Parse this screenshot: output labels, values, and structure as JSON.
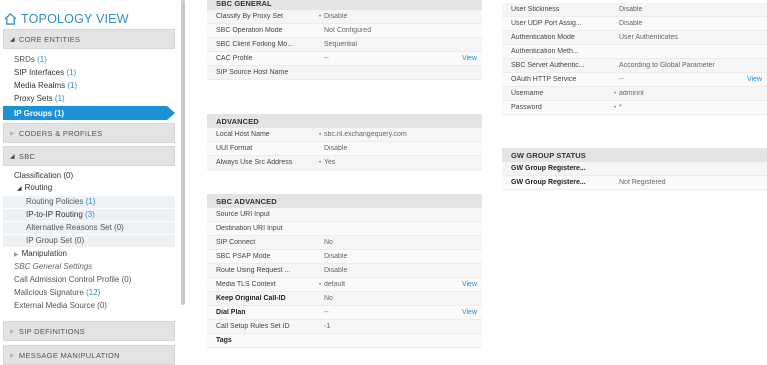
{
  "sidebar": {
    "title": "TOPOLOGY VIEW",
    "core_entities": "CORE ENTITIES",
    "items": [
      {
        "label": "SRDs",
        "count": "(1)"
      },
      {
        "label": "SIP Interfaces",
        "count": "(1)"
      },
      {
        "label": "Media Realms",
        "count": "(1)"
      },
      {
        "label": "Proxy Sets",
        "count": "(1)"
      },
      {
        "label": "IP Groups (1)",
        "count": ""
      }
    ],
    "codecs_profiles": "CODERS & PROFILES",
    "sbc": "SBC",
    "sbc_items": {
      "classification": "Classification (0)",
      "routing": "Routing",
      "routing_policies": "Routing Policies",
      "routing_policies_count": "(1)",
      "ip_to_ip": "IP-to-IP Routing",
      "ip_to_ip_count": "(3)",
      "alt_reasons": "Alternative Reasons Set (0)",
      "ip_group_set": "IP Group Set (0)",
      "manipulation": "Manipulation",
      "general_settings": "SBC General Settings",
      "cac_profile": "Call Admission Control Profile (0)",
      "malicious": "Malicious Signature",
      "malicious_count": "(12)",
      "external_media": "External Media Source (0)"
    },
    "sip_definitions": "SIP DEFINITIONS",
    "message_manipulation": "MESSAGE MANIPULATION"
  },
  "sbc_general": {
    "title": "SBC GENERAL",
    "rows": [
      {
        "label": "Classify By Proxy Set",
        "dot": "•",
        "value": "Disable",
        "view": ""
      },
      {
        "label": "SBC Operation Mode",
        "dot": "",
        "value": "Not Configured",
        "view": ""
      },
      {
        "label": "SBC Client Forking Mo...",
        "dot": "",
        "value": "Sequential",
        "view": ""
      },
      {
        "label": "CAC Profile",
        "dot": "",
        "value": "--",
        "view": "View"
      },
      {
        "label": "SIP Source Host Name",
        "dot": "",
        "value": "",
        "view": ""
      }
    ]
  },
  "advanced": {
    "title": "ADVANCED",
    "rows": [
      {
        "label": "Local Host Name",
        "dot": "•",
        "value": "sbc.nl.exchangequery.com",
        "view": ""
      },
      {
        "label": "UUI Format",
        "dot": "",
        "value": "Disable",
        "view": ""
      },
      {
        "label": "Always Use Src Address",
        "dot": "•",
        "value": "Yes",
        "view": ""
      }
    ]
  },
  "sbc_advanced": {
    "title": "SBC ADVANCED",
    "rows": [
      {
        "label": "Source URI Input",
        "dot": "",
        "value": "",
        "view": "",
        "bold": false
      },
      {
        "label": "Destination URI Input",
        "dot": "",
        "value": "",
        "view": "",
        "bold": false
      },
      {
        "label": "SIP Connect",
        "dot": "",
        "value": "No",
        "view": "",
        "bold": false
      },
      {
        "label": "SBC PSAP Mode",
        "dot": "",
        "value": "Disable",
        "view": "",
        "bold": false
      },
      {
        "label": "Route Using Request ...",
        "dot": "",
        "value": "Disable",
        "view": "",
        "bold": false
      },
      {
        "label": "Media TLS Context",
        "dot": "•",
        "value": "default",
        "view": "View",
        "bold": false
      },
      {
        "label": "Keep Original Call-ID",
        "dot": "",
        "value": "No",
        "view": "",
        "bold": true
      },
      {
        "label": "Dial Plan",
        "dot": "",
        "value": "--",
        "view": "View",
        "bold": true
      },
      {
        "label": "Call Setup Rules Set ID",
        "dot": "",
        "value": "-1",
        "view": "",
        "bold": false
      },
      {
        "label": "Tags",
        "dot": "",
        "value": "",
        "view": "",
        "bold": true
      }
    ]
  },
  "right_top": {
    "rows": [
      {
        "label": "User Stickiness",
        "dot": "",
        "value": "Disable",
        "view": ""
      },
      {
        "label": "User UDP Port Assig...",
        "dot": "",
        "value": "Disable",
        "view": ""
      },
      {
        "label": "Authentication Mode",
        "dot": "",
        "value": "User Authenticates",
        "view": ""
      },
      {
        "label": "Authentication Meth...",
        "dot": "",
        "value": "",
        "view": ""
      },
      {
        "label": "SBC Server Authentic...",
        "dot": "",
        "value": "According to Global Parameter",
        "view": ""
      },
      {
        "label": "OAuth HTTP Service",
        "dot": "",
        "value": "--",
        "view": "View"
      },
      {
        "label": "Username",
        "dot": "•",
        "value": "adminnl",
        "view": ""
      },
      {
        "label": "Password",
        "dot": "•",
        "value": "*",
        "view": ""
      }
    ]
  },
  "gw_status": {
    "title": "GW GROUP STATUS",
    "rows": [
      {
        "label": "GW Group Registere...",
        "dot": "",
        "value": "",
        "view": ""
      },
      {
        "label": "GW Group Registere...",
        "dot": "",
        "value": "Not Registered",
        "view": ""
      }
    ]
  }
}
